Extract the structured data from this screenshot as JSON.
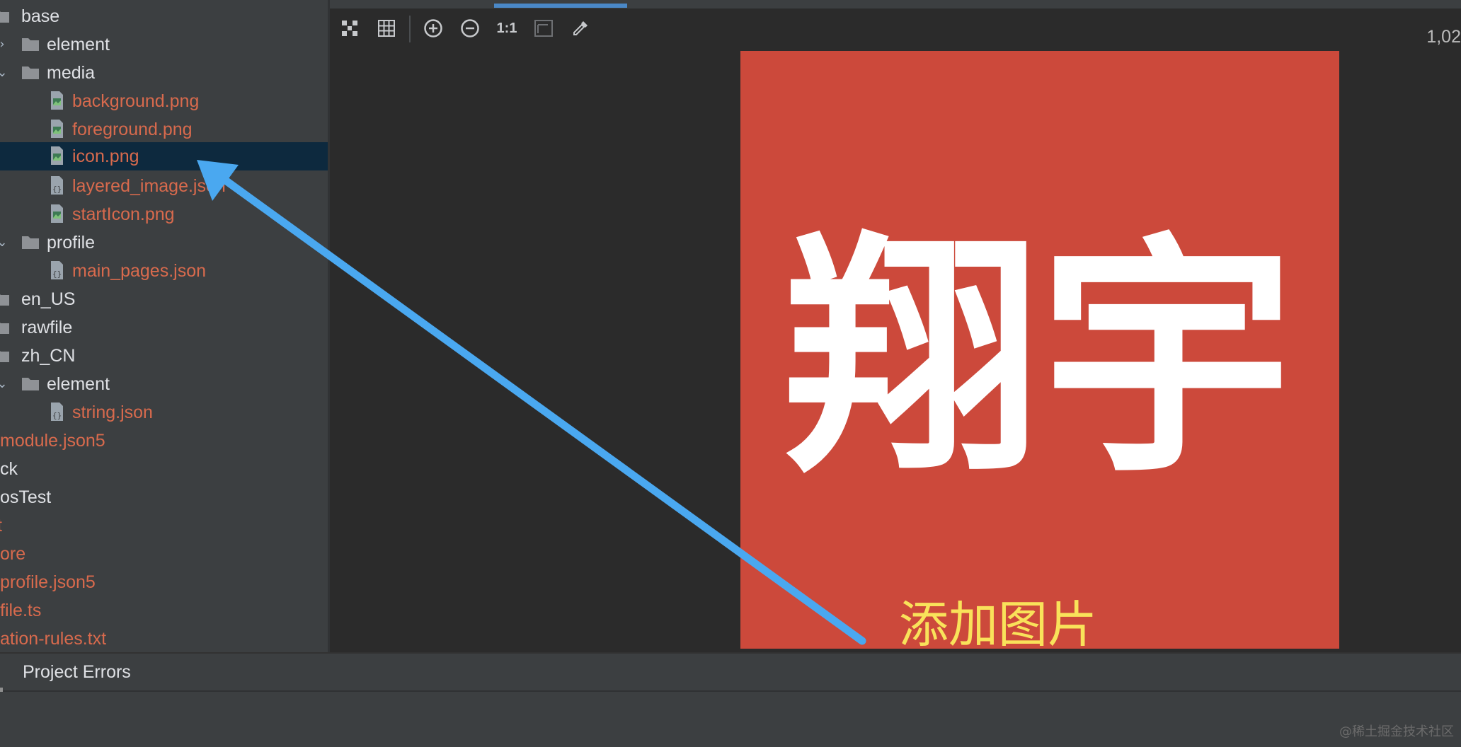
{
  "tree": {
    "items": [
      {
        "label": "base",
        "modified": false
      },
      {
        "label": "element",
        "modified": false
      },
      {
        "label": "media",
        "modified": false
      },
      {
        "label": "background.png",
        "modified": true
      },
      {
        "label": "foreground.png",
        "modified": true
      },
      {
        "label": "icon.png",
        "modified": true
      },
      {
        "label": "layered_image.json",
        "modified": true
      },
      {
        "label": "startIcon.png",
        "modified": true
      },
      {
        "label": "profile",
        "modified": false
      },
      {
        "label": "main_pages.json",
        "modified": true
      },
      {
        "label": "en_US",
        "modified": false
      },
      {
        "label": "rawfile",
        "modified": false
      },
      {
        "label": "zh_CN",
        "modified": false
      },
      {
        "label": "element",
        "modified": false
      },
      {
        "label": "string.json",
        "modified": true
      },
      {
        "label": "module.json5",
        "modified": true
      },
      {
        "label": "ck",
        "modified": false
      },
      {
        "label": "osTest",
        "modified": false
      },
      {
        "label": "t",
        "modified": true
      },
      {
        "label": "ore",
        "modified": true
      },
      {
        "label": "profile.json5",
        "modified": true
      },
      {
        "label": "file.ts",
        "modified": true
      },
      {
        "label": "ation-rules.txt",
        "modified": true
      }
    ],
    "selected_item": "icon.png"
  },
  "viewer": {
    "zoom_readout": "1,02",
    "actual_size_label": "1:1",
    "toolbar_icons": [
      "fit-to-window-icon",
      "grid-icon",
      "zoom-in-icon",
      "zoom-out-icon",
      "actual-size-icon",
      "background-icon",
      "color-picker-icon"
    ],
    "image_text": "翔宇",
    "image_background": "#cc493b"
  },
  "annotation": {
    "caption": "添加图片",
    "caption_color": "#f9e25a",
    "arrow_color": "#4aa8f0"
  },
  "bottom_panel": {
    "tab_label": "Project Errors"
  },
  "watermark": "@稀土掘金技术社区",
  "colors": {
    "modified_file": "#d86a4d",
    "selection": "#0d293e",
    "panel": "#3c3f41"
  }
}
